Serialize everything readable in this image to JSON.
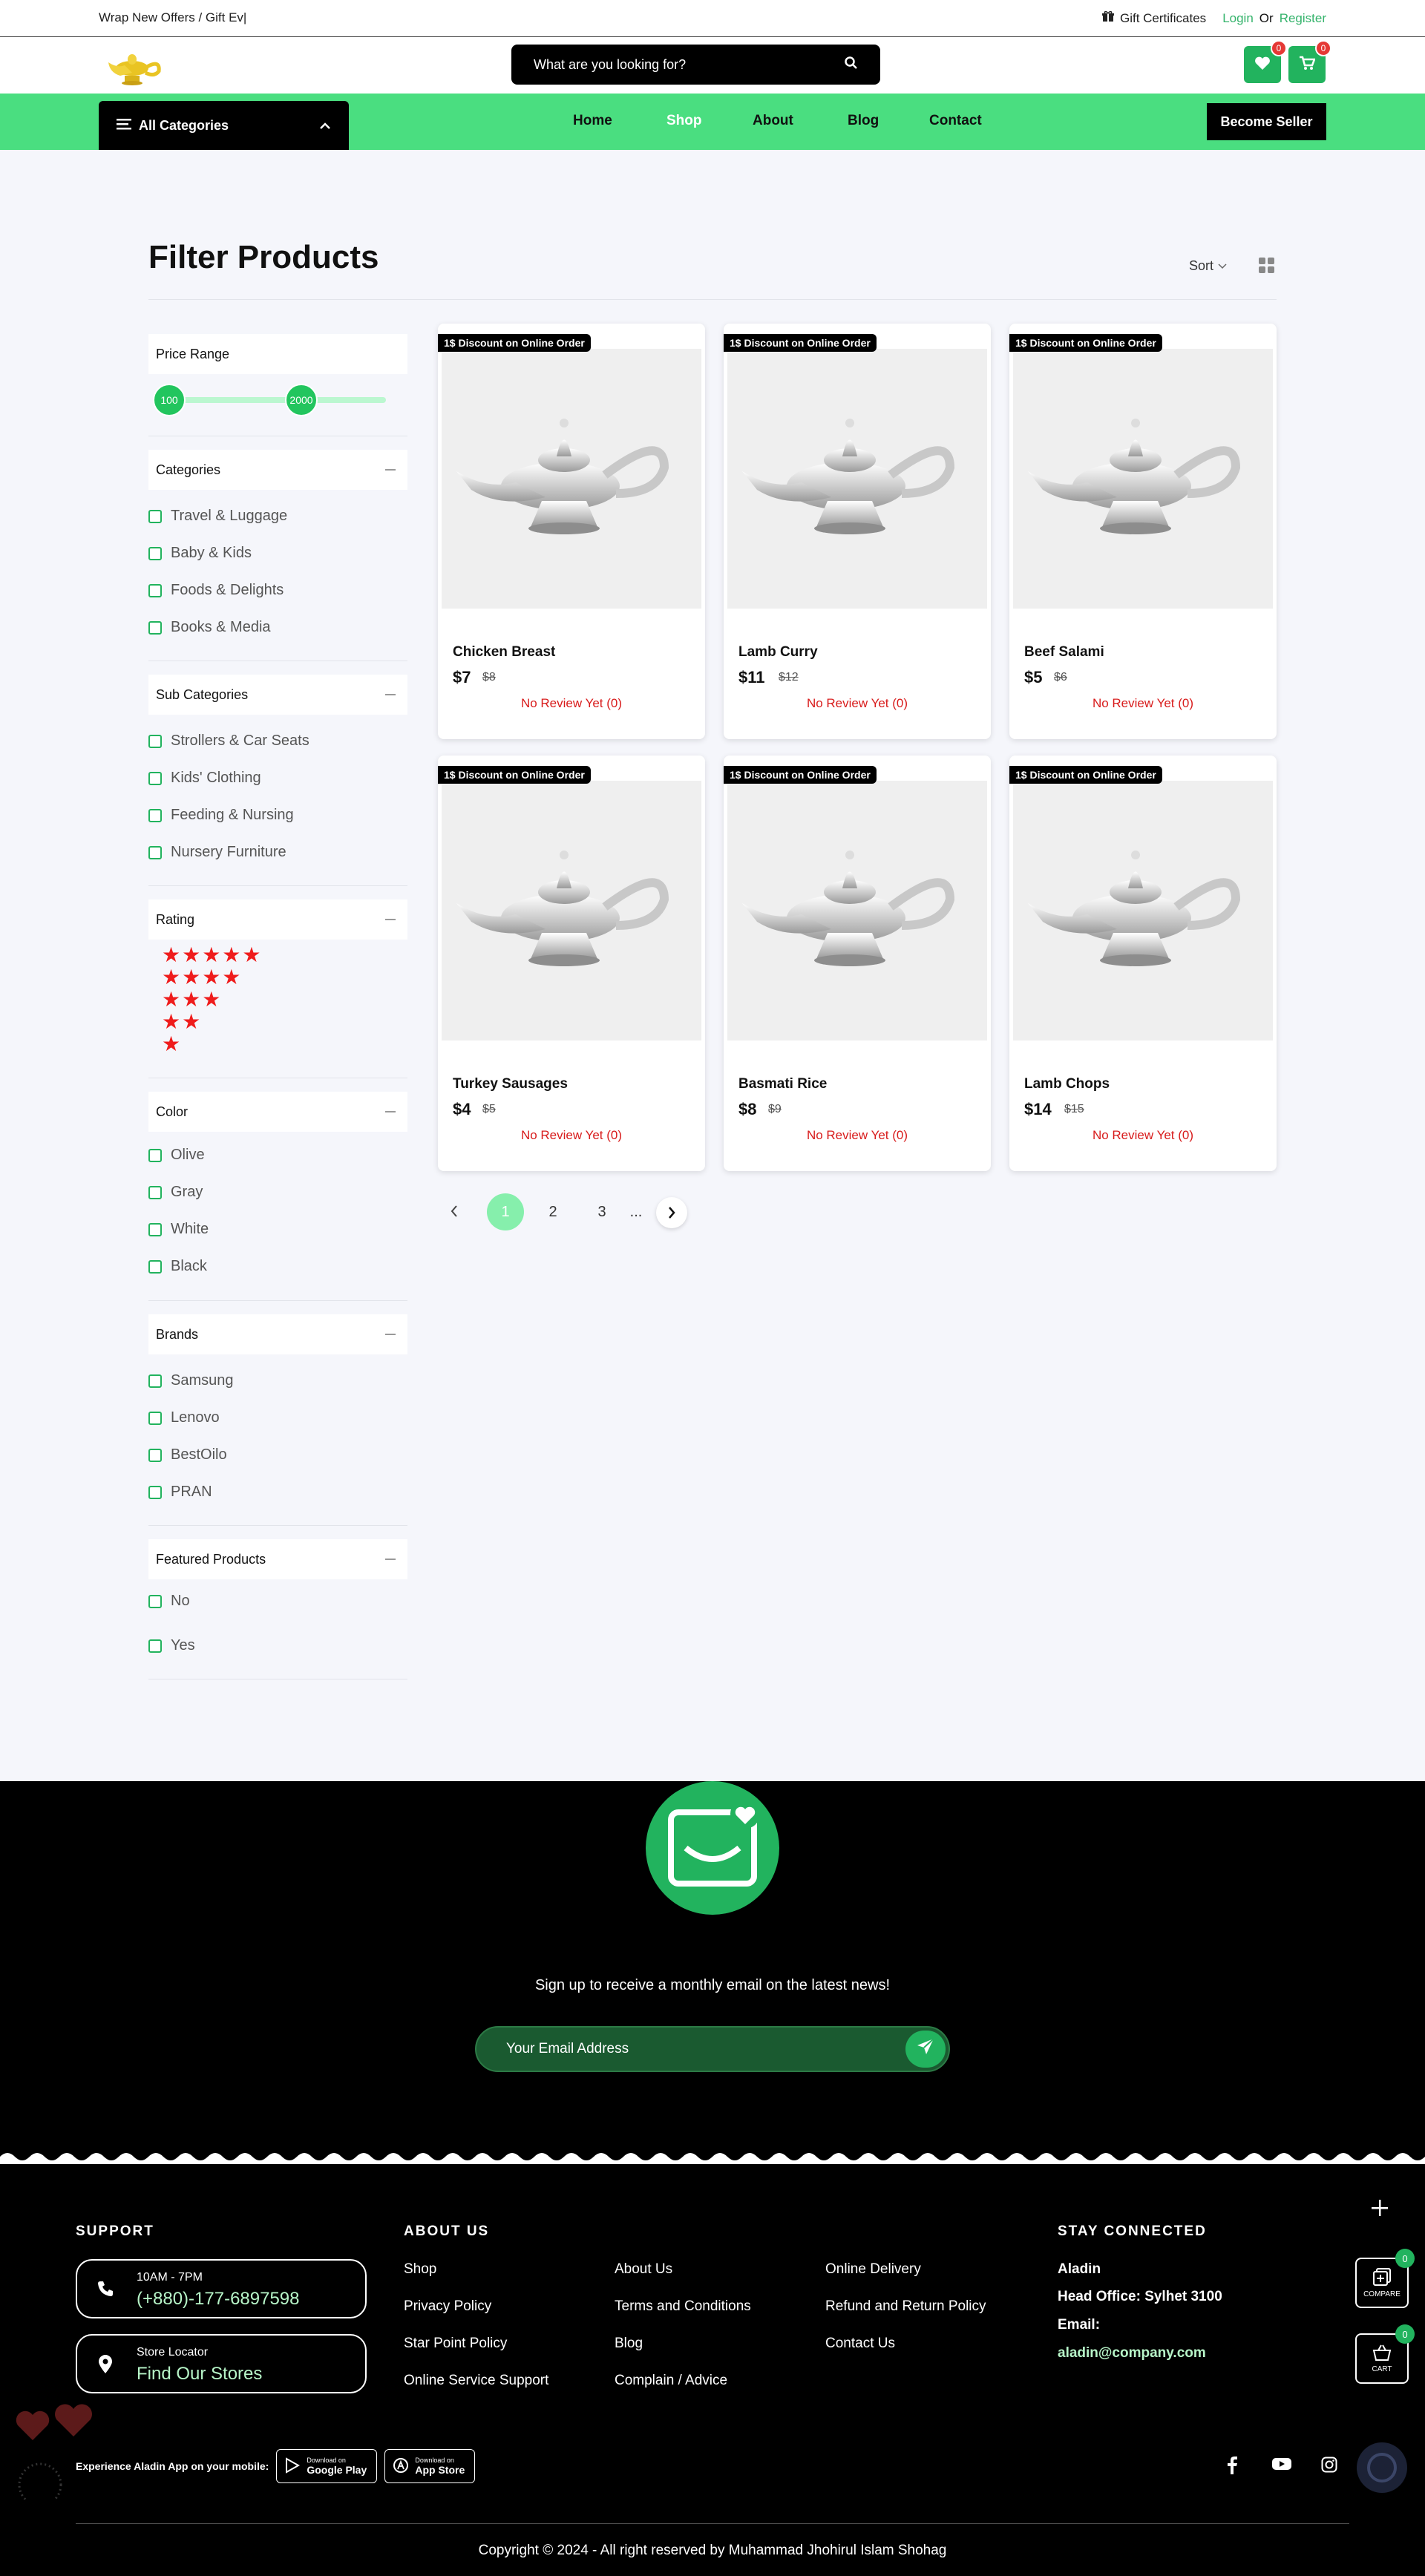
{
  "topbar": {
    "promo": "Wrap New Offers / Gift Ev|",
    "gift_certificates": "Gift Certificates",
    "login": "Login",
    "or": "Or",
    "register": "Register"
  },
  "header": {
    "search_placeholder": "What are you looking for?",
    "wishlist_count": "0",
    "cart_count": "0"
  },
  "nav": {
    "all_categories": "All Categories",
    "links": [
      "Home",
      "Shop",
      "About",
      "Blog",
      "Contact"
    ],
    "active": "Shop",
    "become_seller": "Become Seller"
  },
  "page": {
    "title": "Filter Products",
    "sort_label": "Sort"
  },
  "filters": {
    "price_range": {
      "title": "Price Range",
      "min": "100",
      "max": "2000"
    },
    "categories": {
      "title": "Categories",
      "items": [
        "Travel & Luggage",
        "Baby & Kids",
        "Foods & Delights",
        "Books & Media"
      ]
    },
    "sub_categories": {
      "title": "Sub Categories",
      "items": [
        "Strollers & Car Seats",
        "Kids' Clothing",
        "Feeding & Nursing",
        "Nursery Furniture"
      ]
    },
    "rating": {
      "title": "Rating",
      "levels": [
        5,
        4,
        3,
        2,
        1
      ]
    },
    "color": {
      "title": "Color",
      "items": [
        "Olive",
        "Gray",
        "White",
        "Black"
      ]
    },
    "brands": {
      "title": "Brands",
      "items": [
        "Samsung",
        "Lenovo",
        "BestOilo",
        "PRAN"
      ]
    },
    "featured": {
      "title": "Featured Products",
      "items": [
        "No",
        "Yes"
      ]
    }
  },
  "products": [
    {
      "tag": "1$ Discount on Online Order",
      "name": "Chicken Breast",
      "price": "$7",
      "old_price": "$8",
      "review": "No Review Yet",
      "review_count": "(0)"
    },
    {
      "tag": "1$ Discount on Online Order",
      "name": "Lamb Curry",
      "price": "$11",
      "old_price": "$12",
      "review": "No Review Yet",
      "review_count": "(0)"
    },
    {
      "tag": "1$ Discount on Online Order",
      "name": "Beef Salami",
      "price": "$5",
      "old_price": "$6",
      "review": "No Review Yet",
      "review_count": "(0)"
    },
    {
      "tag": "1$ Discount on Online Order",
      "name": "Turkey Sausages",
      "price": "$4",
      "old_price": "$5",
      "review": "No Review Yet",
      "review_count": "(0)"
    },
    {
      "tag": "1$ Discount on Online Order",
      "name": "Basmati Rice",
      "price": "$8",
      "old_price": "$9",
      "review": "No Review Yet",
      "review_count": "(0)"
    },
    {
      "tag": "1$ Discount on Online Order",
      "name": "Lamb Chops",
      "price": "$14",
      "old_price": "$15",
      "review": "No Review Yet",
      "review_count": "(0)"
    }
  ],
  "pagination": {
    "pages": [
      "1",
      "2",
      "3",
      "..."
    ],
    "current": "1"
  },
  "newsletter": {
    "text": "Sign up to receive a monthly email on the latest news!",
    "placeholder": "Your Email Address"
  },
  "footer": {
    "support": {
      "title": "SUPPORT",
      "hours": "10AM - 7PM",
      "phone": "(+880)-177-6897598",
      "locator_label": "Store Locator",
      "locator_link": "Find Our Stores"
    },
    "about": {
      "title": "ABOUT US",
      "col1": [
        "Shop",
        "Privacy Policy",
        "Star Point Policy",
        "Online Service Support"
      ],
      "col2": [
        "About Us",
        "Terms and Conditions",
        "Blog",
        "Complain / Advice"
      ],
      "col3": [
        "Online Delivery",
        "Refund and Return Policy",
        "Contact Us"
      ]
    },
    "connected": {
      "title": "STAY CONNECTED",
      "name": "Aladin",
      "office": "Head Office: Sylhet 3100",
      "email_label": "Email:",
      "email": "aladin@company.com"
    },
    "app": {
      "label": "Experience Aladin App on your mobile:",
      "google_small": "Download on",
      "google_big": "Google Play",
      "apple_small": "Download on",
      "apple_big": "App Store"
    },
    "compare_label": "COMPARE",
    "compare_count": "0",
    "cart_label": "CART",
    "cart_count": "0",
    "copyright": "Copyright © 2024 - All right reserved by Muhammad Jhohirul Islam Shohag"
  },
  "colors": {
    "brand_green": "#22b35e",
    "nav_green": "#4ade80",
    "review_red": "#d81b1b",
    "star_red": "#ef1c1c"
  }
}
